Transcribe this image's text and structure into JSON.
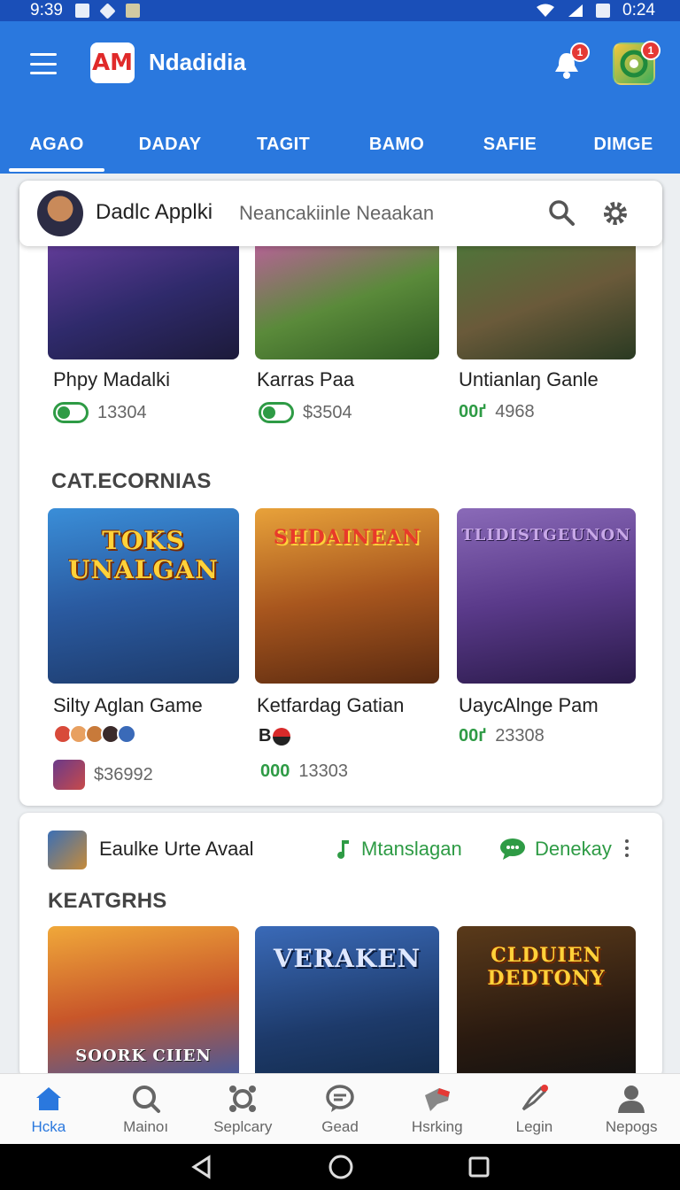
{
  "status_bar": {
    "time": "9:39",
    "right_time": "0:24"
  },
  "app_bar": {
    "logo_text": "AM",
    "title": "Ndadidia",
    "bell_badge": "1",
    "avatar_badge": "1",
    "tabs": [
      "AGAO",
      "DADAY",
      "TAGIT",
      "BAMO",
      "SAFIE",
      "DIMGE"
    ]
  },
  "search_header": {
    "name": "Dadlc Applki",
    "subtitle": "Neancakiinle Neaakan"
  },
  "featured": [
    {
      "title": "Phpy Madalki",
      "value": "13304"
    },
    {
      "title": "Karras Paa",
      "value": "$3504"
    },
    {
      "title": "Untianlaŋ Ganle",
      "prefix": "00ґ",
      "value": "4968"
    }
  ],
  "categories": {
    "heading": "CAT.ECORNIAS",
    "items": [
      {
        "art_title": "TOKS UNALGAN",
        "title": "Silty Aglan Game",
        "value": "$36992"
      },
      {
        "art_title": "SHDAINEAN",
        "title": "Ketfardag Gatian",
        "badge_text": "B",
        "prefix": "000",
        "value": "13303"
      },
      {
        "art_title": "TLIDISTGEUNON",
        "title": "UaycAlnge Pam",
        "prefix": "00ґ",
        "value": "23308"
      }
    ]
  },
  "second_card": {
    "label": "Eaulke Urte Avaal",
    "action1": "Mtanslagan",
    "action2": "Denekay",
    "heading": "KEATGRHS",
    "items": [
      {
        "art_title": "SOORK CIIEN"
      },
      {
        "art_title": "VERAKEN"
      },
      {
        "art_title": "CLDUIEN DEDTONY"
      }
    ]
  },
  "bottom_nav": [
    "Hcka",
    "Mainoı",
    "Seplcary",
    "Gead",
    "Hsrking",
    "Legin",
    "Nepogs"
  ],
  "colors": {
    "primary": "#2a78de",
    "accent_green": "#2e9b45",
    "badge_red": "#e53935"
  }
}
